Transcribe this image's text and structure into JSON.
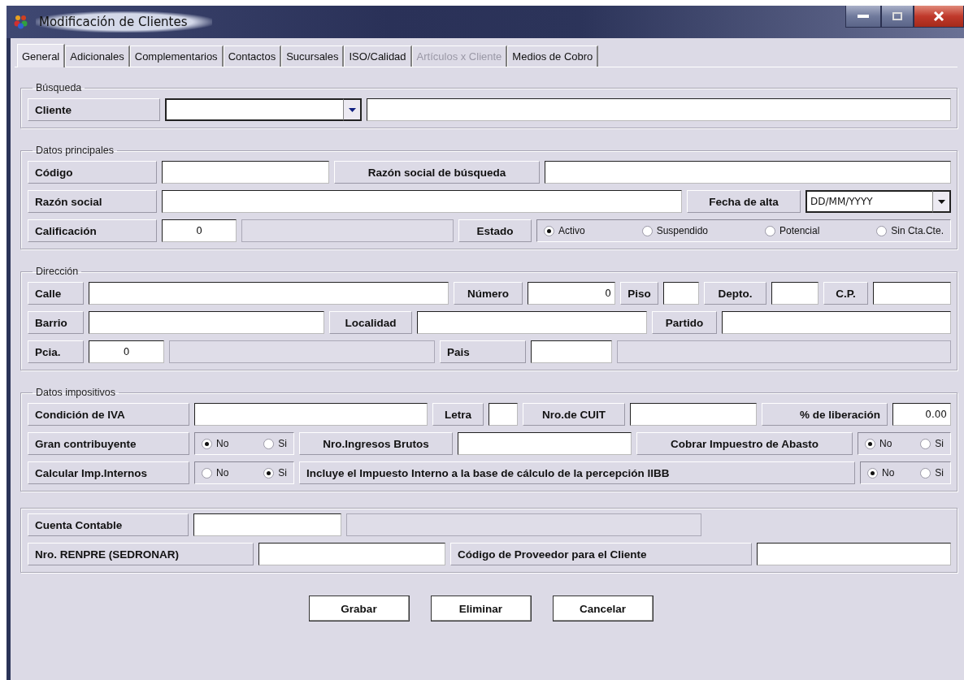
{
  "window": {
    "title": "Modificación de Clientes"
  },
  "tabs": [
    {
      "label": "General",
      "selected": true,
      "disabled": false
    },
    {
      "label": "Adicionales",
      "selected": false,
      "disabled": false
    },
    {
      "label": "Complementarios",
      "selected": false,
      "disabled": false
    },
    {
      "label": "Contactos",
      "selected": false,
      "disabled": false
    },
    {
      "label": "Sucursales",
      "selected": false,
      "disabled": false
    },
    {
      "label": "ISO/Calidad",
      "selected": false,
      "disabled": false
    },
    {
      "label": "Artículos x Cliente",
      "selected": false,
      "disabled": true
    },
    {
      "label": "Medios de Cobro",
      "selected": false,
      "disabled": false
    }
  ],
  "groups": [
    {
      "legend": "Búsqueda",
      "rows": [
        {
          "fields": [
            {
              "kind": "label",
              "text": "Cliente"
            },
            {
              "kind": "combo"
            },
            {
              "kind": "input"
            }
          ]
        }
      ]
    },
    {
      "legend": "Datos principales",
      "rows": [
        {
          "fields": [
            {
              "kind": "label",
              "text": "Código"
            },
            {
              "kind": "input"
            },
            {
              "kind": "label",
              "text": "Razón social de búsqueda"
            },
            {
              "kind": "input"
            }
          ]
        },
        {
          "fields": [
            {
              "kind": "label",
              "text": "Razón social"
            },
            {
              "kind": "input"
            },
            {
              "kind": "label",
              "text": "Fecha de alta"
            },
            {
              "kind": "date",
              "value": "DD/MM/YYYY"
            }
          ]
        },
        {
          "fields": [
            {
              "kind": "label",
              "text": "Calificación"
            },
            {
              "kind": "input",
              "value": "0"
            },
            {
              "kind": "readonly"
            },
            {
              "kind": "label",
              "text": "Estado"
            },
            {
              "kind": "radios",
              "options": [
                {
                  "label": "Activo",
                  "selected": true
                },
                {
                  "label": "Suspendido",
                  "selected": false
                },
                {
                  "label": "Potencial",
                  "selected": false
                },
                {
                  "label": "Sin Cta.Cte.",
                  "selected": false
                }
              ]
            }
          ]
        }
      ]
    },
    {
      "legend": "Dirección",
      "rows": [
        {
          "fields": [
            {
              "kind": "label",
              "text": "Calle"
            },
            {
              "kind": "input"
            },
            {
              "kind": "label",
              "text": "Número"
            },
            {
              "kind": "input",
              "value": "0"
            },
            {
              "kind": "label",
              "text": "Piso"
            },
            {
              "kind": "input"
            },
            {
              "kind": "label",
              "text": "Depto."
            },
            {
              "kind": "input"
            },
            {
              "kind": "label",
              "text": "C.P."
            },
            {
              "kind": "input"
            }
          ]
        },
        {
          "fields": [
            {
              "kind": "label",
              "text": "Barrio"
            },
            {
              "kind": "input"
            },
            {
              "kind": "label",
              "text": "Localidad"
            },
            {
              "kind": "input"
            },
            {
              "kind": "label",
              "text": "Partido"
            },
            {
              "kind": "input"
            }
          ]
        },
        {
          "fields": [
            {
              "kind": "label",
              "text": "Pcia."
            },
            {
              "kind": "input",
              "value": "0"
            },
            {
              "kind": "readonly"
            },
            {
              "kind": "label",
              "text": "Pais"
            },
            {
              "kind": "input"
            },
            {
              "kind": "readonly"
            }
          ]
        }
      ]
    },
    {
      "legend": "Datos impositivos",
      "rows": [
        {
          "fields": [
            {
              "kind": "label",
              "text": "Condición de IVA"
            },
            {
              "kind": "input"
            },
            {
              "kind": "label",
              "text": "Letra"
            },
            {
              "kind": "input"
            },
            {
              "kind": "label",
              "text": "Nro.de CUIT"
            },
            {
              "kind": "input"
            },
            {
              "kind": "label",
              "text": "% de liberación"
            },
            {
              "kind": "input",
              "value": "0.00"
            }
          ]
        },
        {
          "fields": [
            {
              "kind": "label",
              "text": "Gran contribuyente"
            },
            {
              "kind": "radios",
              "options": [
                {
                  "label": "No",
                  "selected": true
                },
                {
                  "label": "Si",
                  "selected": false
                }
              ]
            },
            {
              "kind": "label",
              "text": "Nro.Ingresos Brutos"
            },
            {
              "kind": "input"
            },
            {
              "kind": "label",
              "text": "Cobrar Impuestro de Abasto"
            },
            {
              "kind": "radios",
              "options": [
                {
                  "label": "No",
                  "selected": true
                },
                {
                  "label": "Si",
                  "selected": false
                }
              ]
            }
          ]
        },
        {
          "fields": [
            {
              "kind": "label",
              "text": "Calcular Imp.Internos"
            },
            {
              "kind": "radios",
              "options": [
                {
                  "label": "No",
                  "selected": false
                },
                {
                  "label": "Si",
                  "selected": true
                }
              ]
            },
            {
              "kind": "label",
              "text": "Incluye el Impuesto Interno a la base de cálculo de la percepción IIBB"
            },
            {
              "kind": "radios",
              "options": [
                {
                  "label": "No",
                  "selected": true
                },
                {
                  "label": "Si",
                  "selected": false
                }
              ]
            }
          ]
        }
      ]
    },
    {
      "rows": [
        {
          "fields": [
            {
              "kind": "label",
              "text": "Cuenta Contable"
            },
            {
              "kind": "input"
            },
            {
              "kind": "readonly"
            }
          ]
        },
        {
          "fields": [
            {
              "kind": "label",
              "text": "Nro. RENPRE (SEDRONAR)"
            },
            {
              "kind": "input"
            },
            {
              "kind": "label",
              "text": "Código de Proveedor para el Cliente"
            },
            {
              "kind": "input"
            }
          ]
        }
      ]
    }
  ],
  "buttons": [
    "Grabar",
    "Eliminar",
    "Cancelar"
  ]
}
